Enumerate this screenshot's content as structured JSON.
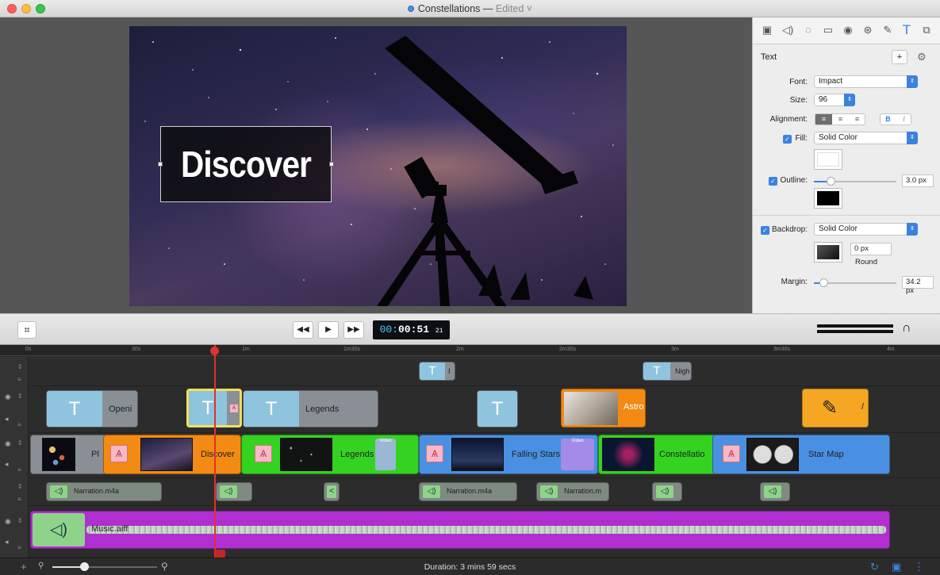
{
  "window": {
    "title": "Constellations",
    "separator": "—",
    "status": "Edited",
    "traffic_lights": {
      "close": "#fc605c",
      "minimize": "#fdbc40",
      "zoom": "#34c84a"
    }
  },
  "viewer": {
    "overlay_text": "Discover"
  },
  "inspector": {
    "toolbar_icons": [
      "media-icon",
      "audio-icon",
      "speed-icon",
      "screen-icon",
      "cursor-icon",
      "effects-icon",
      "annotate-icon",
      "text-icon",
      "layers-icon"
    ],
    "section_title": "Text",
    "add_label": "+",
    "gear_label": "⚙",
    "font_label": "Font:",
    "font_value": "Impact",
    "size_label": "Size:",
    "size_value": "96",
    "alignment_label": "Alignment:",
    "bold_label": "B",
    "italic_label": "I",
    "fill_label": "Fill:",
    "fill_value": "Solid Color",
    "outline_label": "Outline:",
    "outline_value": "3.0 px",
    "backdrop_label": "Backdrop:",
    "backdrop_value": "Solid Color",
    "corner_value": "0 px",
    "corner_style": "Round",
    "margin_label": "Margin:",
    "margin_value": "34.2 px",
    "outline_slider": 0.2,
    "margin_slider": 0.12,
    "accent": "#3b82e0"
  },
  "transport": {
    "rewind": "◀◀",
    "play": "▶",
    "forward": "▶▶",
    "tc_prefix": "00:",
    "tc_main": "00:51",
    "tc_frames": "21"
  },
  "ruler": {
    "ticks": [
      "0s",
      "30s",
      "1m",
      "1m30s",
      "2m",
      "2m30s",
      "3m",
      "3m30s",
      "4m"
    ]
  },
  "tracks": {
    "title_track_1": [
      {
        "label": "I"
      },
      {
        "label": "Nigh"
      }
    ],
    "title_track_2": [
      {
        "label": "Openi"
      },
      {
        "label": ""
      },
      {
        "label": "Legends"
      },
      {
        "label": ""
      },
      {
        "label": "Astro"
      },
      {
        "label": "/"
      }
    ],
    "video_track": [
      {
        "label": "Pl"
      },
      {
        "label": "Discover"
      },
      {
        "label": "Legends"
      },
      {
        "label": "Falling Stars"
      },
      {
        "label": "Constellatio"
      },
      {
        "label": "Star Map"
      }
    ],
    "audio_track": [
      {
        "label": "Narration.m4a"
      },
      {
        "label": ""
      },
      {
        "label": ""
      },
      {
        "label": "Narration.m4a"
      },
      {
        "label": "Narration.m"
      },
      {
        "label": ""
      },
      {
        "label": ""
      }
    ],
    "music_track": {
      "label": "Music.aiff"
    },
    "badge_video": "Video"
  },
  "status_bar": {
    "add": "+",
    "duration": "Duration: 3 mins 59 secs",
    "zoom_fraction": 0.3
  }
}
